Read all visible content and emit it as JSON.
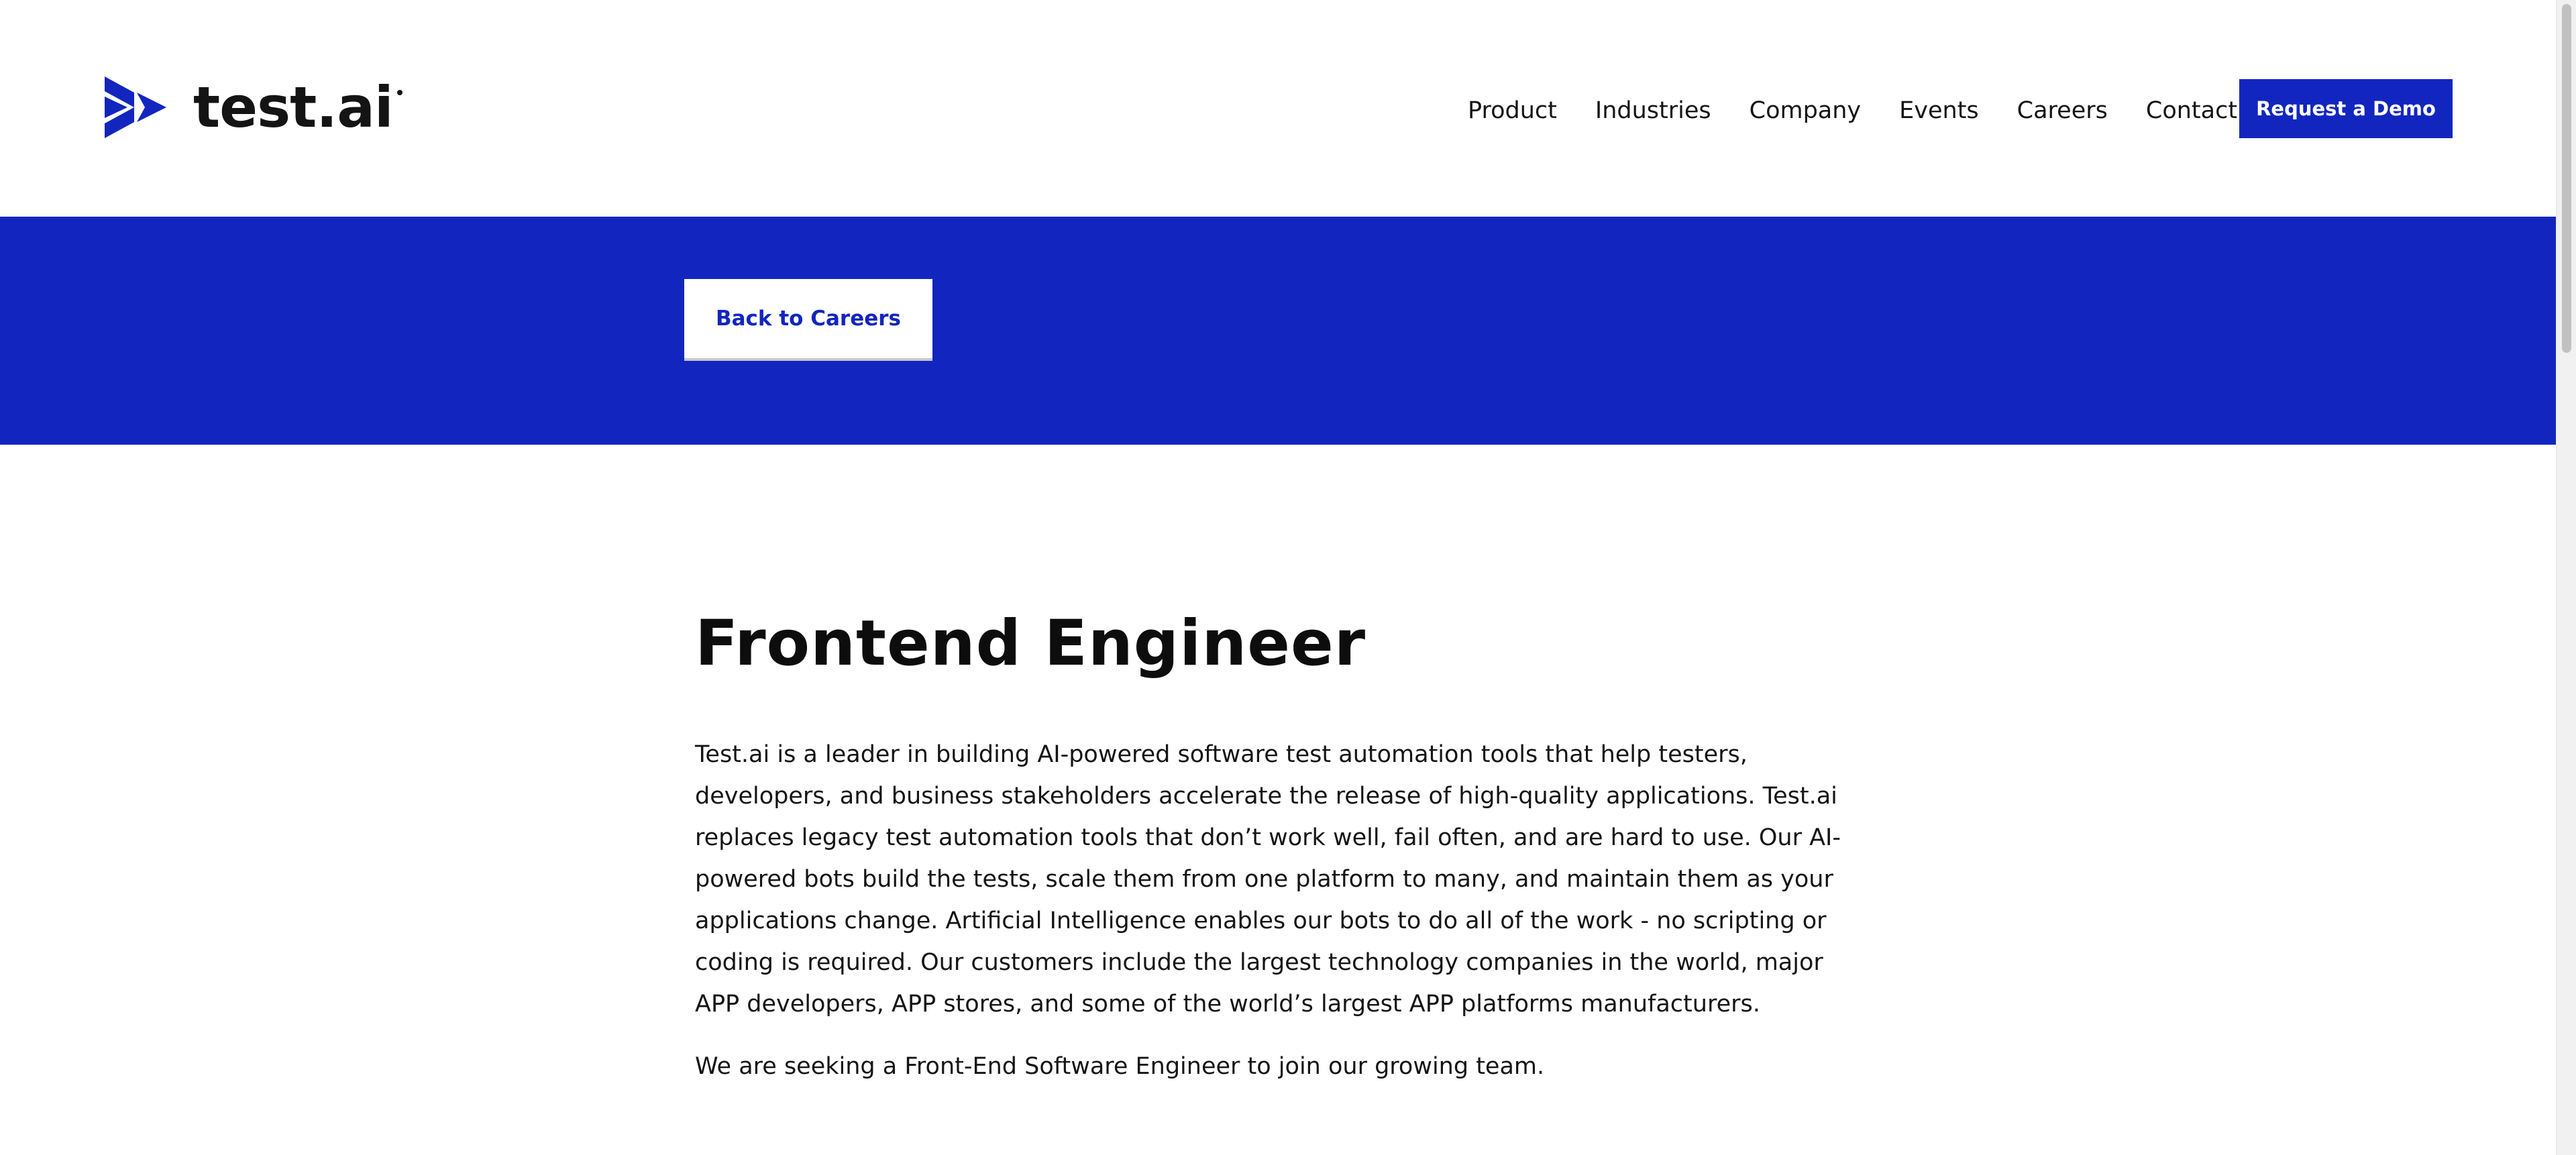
{
  "brand": {
    "name": "test.ai",
    "color": "#1226bf"
  },
  "nav": {
    "items": [
      "Product",
      "Industries",
      "Company",
      "Events",
      "Careers",
      "Contact"
    ],
    "cta_label": "Request a Demo"
  },
  "banner": {
    "back_label": "Back to Careers",
    "background": "#1226bf"
  },
  "job": {
    "title": "Frontend Engineer",
    "intro": "Test.ai is a leader in building AI-powered software test automation tools that help testers, developers, and business stakeholders accelerate the release of high-quality applications. Test.ai replaces legacy test automation tools that don’t work well, fail often, and are hard to use. Our AI-powered bots build the tests, scale them from one platform to many, and maintain them as your applications change. Artificial Intelligence enables our bots to do all of the work - no scripting or coding is required. Our customers include the largest technology companies in the world, major APP developers, APP stores, and some of the world’s largest APP platforms manufacturers.",
    "seeking": "We are seeking a Front-End Software Engineer to join our growing team."
  }
}
